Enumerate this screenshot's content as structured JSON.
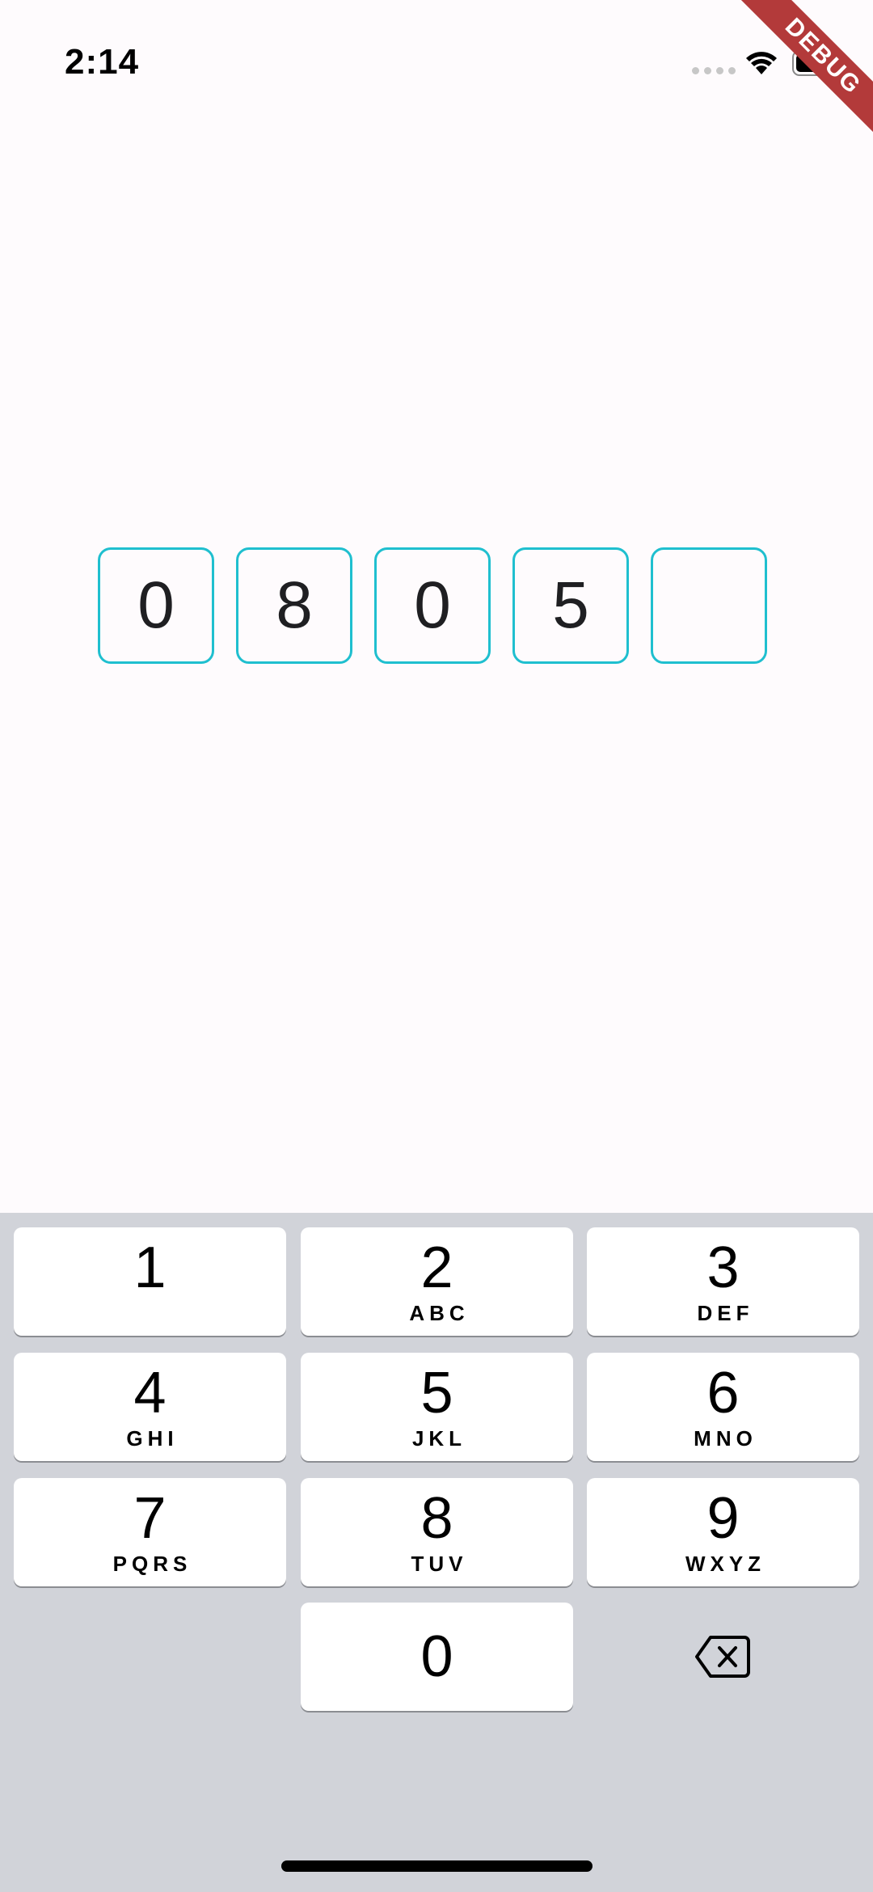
{
  "status_bar": {
    "time": "2:14",
    "debug_label": "DEBUG"
  },
  "pin": {
    "digits": [
      "0",
      "8",
      "0",
      "5",
      ""
    ]
  },
  "keypad": {
    "keys": [
      {
        "digit": "1",
        "letters": ""
      },
      {
        "digit": "2",
        "letters": "ABC"
      },
      {
        "digit": "3",
        "letters": "DEF"
      },
      {
        "digit": "4",
        "letters": "GHI"
      },
      {
        "digit": "5",
        "letters": "JKL"
      },
      {
        "digit": "6",
        "letters": "MNO"
      },
      {
        "digit": "7",
        "letters": "PQRS"
      },
      {
        "digit": "8",
        "letters": "TUV"
      },
      {
        "digit": "9",
        "letters": "WXYZ"
      },
      {
        "digit": "0",
        "letters": ""
      }
    ],
    "backspace_icon": "backspace-icon"
  },
  "colors": {
    "pin_border": "#1fbfcf",
    "keypad_bg": "#d1d3d9",
    "debug_ribbon": "#b33a3a"
  }
}
